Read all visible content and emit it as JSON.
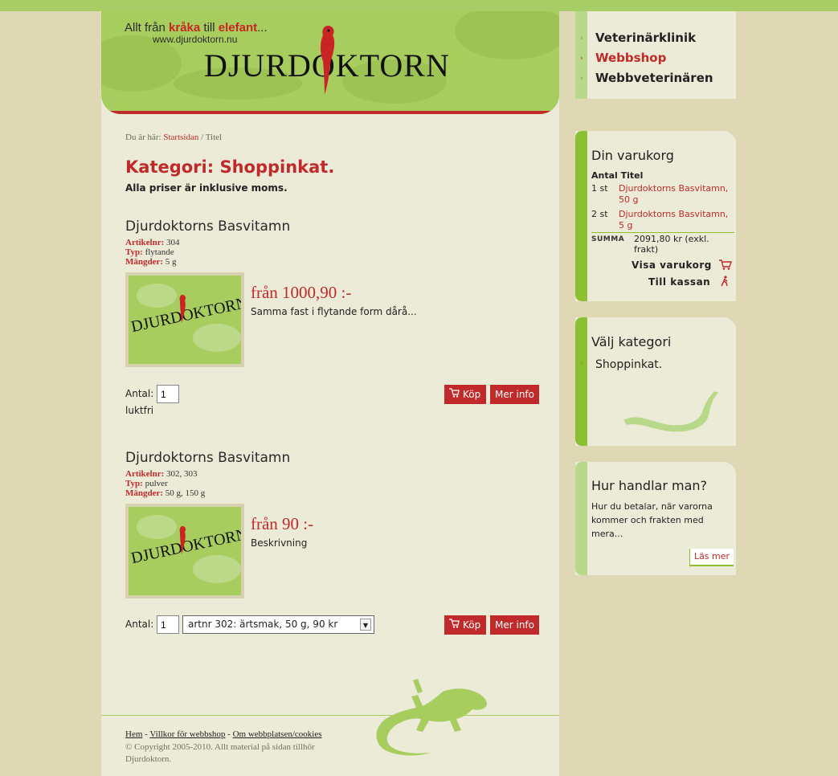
{
  "header": {
    "tagline_a": "Allt från",
    "tagline_b": "kråka",
    "tagline_c": "till",
    "tagline_d": "elefant",
    "tagline_e": "...",
    "url": "www.djurdoktorn.nu",
    "logo": "DJURDOKTORN"
  },
  "breadcrumb": {
    "prefix": "Du är här:",
    "home": "Startsidan",
    "sep": " / ",
    "current": "Titel"
  },
  "page": {
    "title": "Kategori: Shoppinkat.",
    "note": "Alla priser är inklusive moms."
  },
  "labels": {
    "artnr": "Artikelnr:",
    "type": "Typ:",
    "amounts": "Mängder:",
    "qty": "Antal:",
    "buy": "Köp",
    "more_info": "Mer info"
  },
  "products": [
    {
      "name": "Djurdoktorns Basvitamn",
      "artnr": "304",
      "type": "flytande",
      "amounts": "5 g",
      "price": "från 1000,90 :-",
      "desc": "Samma fast i flytande form dårå...",
      "qty": "1",
      "note": "luktfri",
      "thumb_logo": "DJURDOKTORN"
    },
    {
      "name": "Djurdoktorns Basvitamn",
      "artnr": "302, 303",
      "type": "pulver",
      "amounts": "50 g, 150 g",
      "price": "från 90 :-",
      "desc": "Beskrivning",
      "qty": "1",
      "variant": "artnr 302: ärtsmak, 50 g, 90 kr",
      "thumb_logo": "DJURDOKTORN"
    }
  ],
  "footer": {
    "links": [
      "Hem",
      "Villkor för webbshop",
      "Om webbplatsen/cookies"
    ],
    "sep": " - ",
    "copyright": "© Copyright 2005-2010. Allt material på sidan tillhör Djurdoktorn."
  },
  "nav": {
    "items": [
      {
        "label": "Veterinärklinik",
        "active": false
      },
      {
        "label": "Webbshop",
        "active": true
      },
      {
        "label": "Webbveterinären",
        "active": false
      }
    ]
  },
  "cart": {
    "title": "Din varukorg",
    "col_qty": "Antal",
    "col_title": "Titel",
    "rows": [
      {
        "qty": "1 st",
        "title": "Djurdoktorns Basvitamn, 50 g"
      },
      {
        "qty": "2 st",
        "title": "Djurdoktorns Basvitamn, 5 g"
      }
    ],
    "sum_label": "SUMMA",
    "sum_value": "2091,80 kr (exkl. frakt)",
    "view_cart": "Visa varukorg",
    "checkout": "Till kassan"
  },
  "categories": {
    "title": "Välj kategori",
    "items": [
      "Shoppinkat."
    ]
  },
  "help": {
    "title": "Hur handlar man?",
    "text": "Hur du betalar, när varorna kommer och frakten med mera...",
    "read_more": "Läs mer"
  },
  "colors": {
    "accent": "#c02a2a",
    "green": "#a8cd5f",
    "stripe": "#8dbf33",
    "page_bg": "#ded8b5",
    "content_bg": "#ecebd8"
  },
  "icons": {
    "parrot": "parrot-icon",
    "cart": "cart-icon",
    "walker": "walker-icon",
    "lizard": "lizard-icon",
    "snake": "snake-icon",
    "arrow": "arrow-icon"
  }
}
